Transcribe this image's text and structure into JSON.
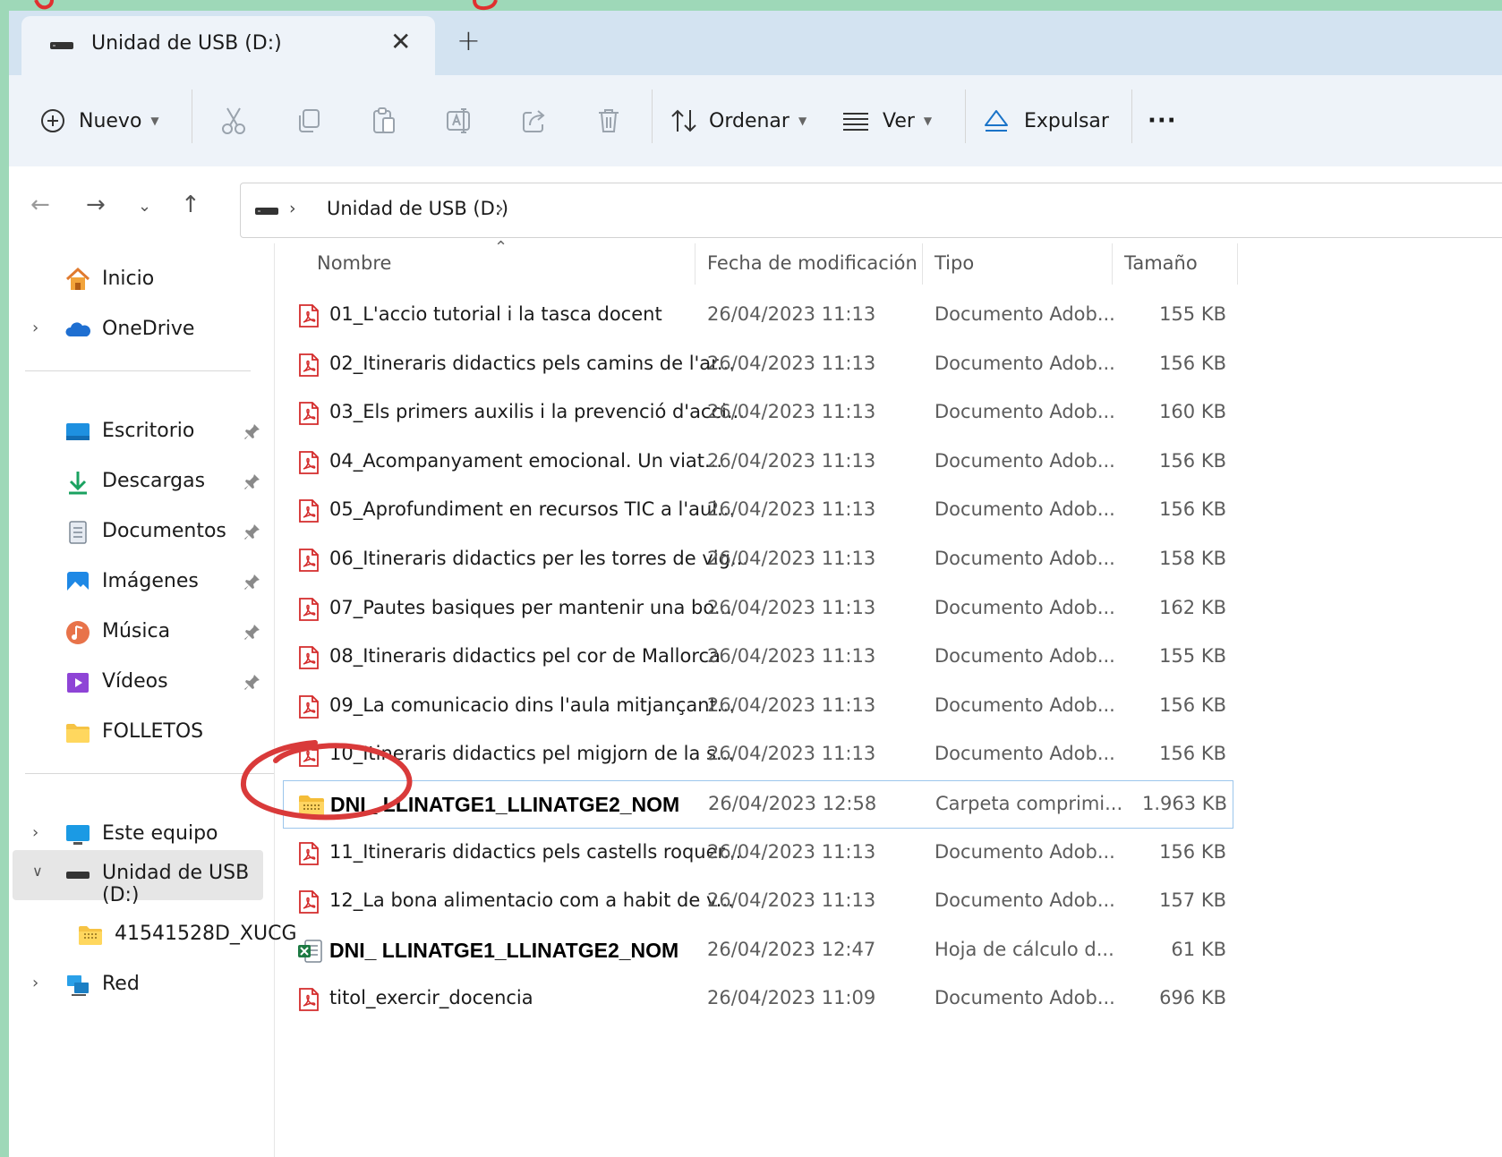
{
  "window": {
    "tab_title": "Unidad de USB (D:)",
    "tab_close": "✕",
    "new_tab": "+"
  },
  "toolbar": {
    "new_label": "Nuevo",
    "sort_label": "Ordenar",
    "view_label": "Ver",
    "eject_label": "Expulsar",
    "more_label": "···"
  },
  "address": {
    "path": "Unidad de USB (D:)"
  },
  "sidebar": {
    "items": [
      {
        "label": "Inicio"
      },
      {
        "label": "OneDrive"
      },
      {
        "label": "Escritorio"
      },
      {
        "label": "Descargas"
      },
      {
        "label": "Documentos"
      },
      {
        "label": "Imágenes"
      },
      {
        "label": "Música"
      },
      {
        "label": "Vídeos"
      },
      {
        "label": "FOLLETOS"
      },
      {
        "label": "Este equipo"
      },
      {
        "label": "Unidad de USB (D:)"
      },
      {
        "label": "41541528D_XUCG"
      },
      {
        "label": "Red"
      }
    ]
  },
  "columns": {
    "name": "Nombre",
    "date": "Fecha de modificación",
    "type": "Tipo",
    "size": "Tamaño"
  },
  "files": [
    {
      "name": "01_L'accio tutorial i la tasca docent",
      "date": "26/04/2023 11:13",
      "type": "Documento Adob...",
      "size": "155 KB",
      "icon": "pdf-icon"
    },
    {
      "name": "02_Itineraris didactics pels camins de l'ar...",
      "date": "26/04/2023 11:13",
      "type": "Documento Adob...",
      "size": "156 KB",
      "icon": "pdf-icon"
    },
    {
      "name": "03_Els primers auxilis i la prevenció d'acci...",
      "date": "26/04/2023 11:13",
      "type": "Documento Adob...",
      "size": "160 KB",
      "icon": "pdf-icon"
    },
    {
      "name": "04_Acompanyament emocional. Un viat...",
      "date": "26/04/2023 11:13",
      "type": "Documento Adob...",
      "size": "156 KB",
      "icon": "pdf-icon"
    },
    {
      "name": "05_Aprofundiment en recursos TIC a l'aul...",
      "date": "26/04/2023 11:13",
      "type": "Documento Adob...",
      "size": "156 KB",
      "icon": "pdf-icon"
    },
    {
      "name": "06_Itineraris didactics per les torres de vig...",
      "date": "26/04/2023 11:13",
      "type": "Documento Adob...",
      "size": "158 KB",
      "icon": "pdf-icon"
    },
    {
      "name": "07_Pautes basiques per mantenir una bo...",
      "date": "26/04/2023 11:13",
      "type": "Documento Adob...",
      "size": "162 KB",
      "icon": "pdf-icon"
    },
    {
      "name": "08_Itineraris didactics pel cor de Mallorca",
      "date": "26/04/2023 11:13",
      "type": "Documento Adob...",
      "size": "155 KB",
      "icon": "pdf-icon"
    },
    {
      "name": "09_La comunicacio dins l'aula mitjançant...",
      "date": "26/04/2023 11:13",
      "type": "Documento Adob...",
      "size": "156 KB",
      "icon": "pdf-icon"
    },
    {
      "name": "10_Itineraris didactics pel migjorn de la s...",
      "date": "26/04/2023 11:13",
      "type": "Documento Adob...",
      "size": "156 KB",
      "icon": "pdf-icon"
    },
    {
      "name": "DNI_ LLINATGE1_LLINATGE2_NOM",
      "date": "26/04/2023 12:58",
      "type": "Carpeta comprimi...",
      "size": "1.963 KB",
      "icon": "zip-folder-icon"
    },
    {
      "name": "11_Itineraris didactics pels castells roquer...",
      "date": "26/04/2023 11:13",
      "type": "Documento Adob...",
      "size": "156 KB",
      "icon": "pdf-icon"
    },
    {
      "name": "12_La bona alimentacio com a habit de v...",
      "date": "26/04/2023 11:13",
      "type": "Documento Adob...",
      "size": "157 KB",
      "icon": "pdf-icon"
    },
    {
      "name": "DNI_ LLINATGE1_LLINATGE2_NOM",
      "date": "26/04/2023 12:47",
      "type": "Hoja de cálculo d...",
      "size": "61 KB",
      "icon": "excel-icon"
    },
    {
      "name": "titol_exercir_docencia",
      "date": "26/04/2023 11:09",
      "type": "Documento Adob...",
      "size": "696 KB",
      "icon": "pdf-icon"
    }
  ],
  "colors": {
    "accent_red": "#d93a3a",
    "tab_bar": "#d3e3f1",
    "command_bar": "#eef3f9",
    "selected_sidebar": "#e6e6e6",
    "page_background": "#9ed8b8"
  }
}
